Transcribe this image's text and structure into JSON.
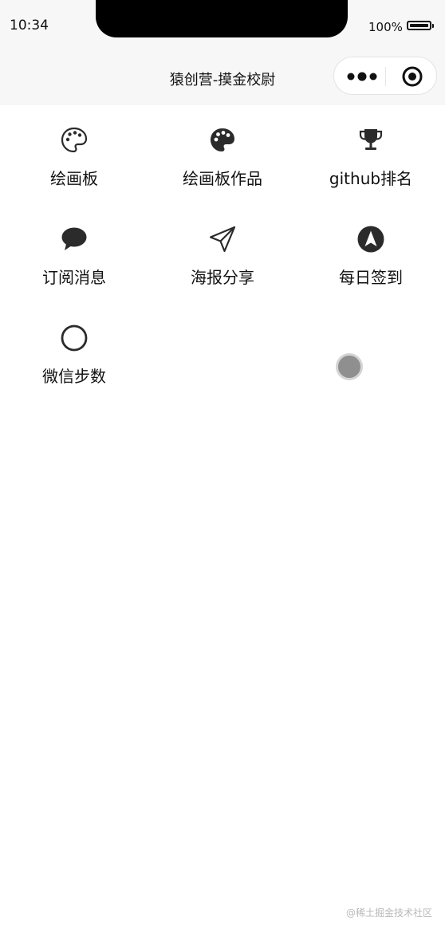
{
  "status_bar": {
    "time": "10:34",
    "battery": "100%"
  },
  "nav": {
    "title": "猿创营-摸金校尉"
  },
  "grid": {
    "items": [
      {
        "label": "绘画板",
        "icon": "palette-outline-icon"
      },
      {
        "label": "绘画板作品",
        "icon": "palette-filled-icon"
      },
      {
        "label": "github排名",
        "icon": "trophy-icon"
      },
      {
        "label": "订阅消息",
        "icon": "chat-bubble-icon"
      },
      {
        "label": "海报分享",
        "icon": "send-icon"
      },
      {
        "label": "每日签到",
        "icon": "navigation-arrow-icon"
      },
      {
        "label": "微信步数",
        "icon": "circle-icon"
      }
    ]
  },
  "watermark": "@稀土掘金技术社区",
  "colors": {
    "header_bg": "#f7f7f7",
    "icon": "#2b2b2b",
    "loader": "#8f8f8f"
  }
}
